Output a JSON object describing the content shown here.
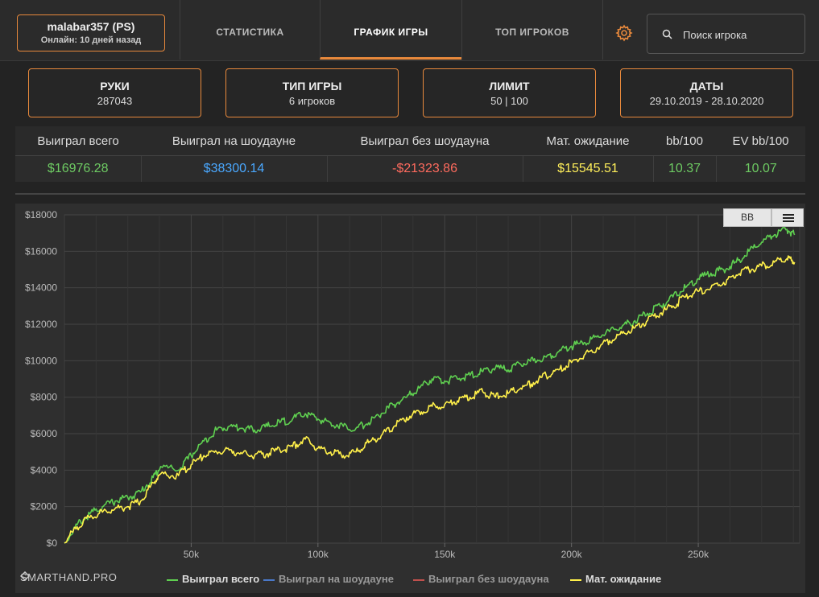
{
  "player": {
    "name": "malabar357 (PS)",
    "status": "Онлайн: 10 дней назад"
  },
  "nav": {
    "tabs": [
      {
        "label": "СТАТИСТИКА"
      },
      {
        "label": "ГРАФИК ИГРЫ"
      },
      {
        "label": "ТОП ИГРОКОВ"
      }
    ]
  },
  "search": {
    "placeholder": "Поиск игрока"
  },
  "cards": [
    {
      "title": "РУКИ",
      "value": "287043"
    },
    {
      "title": "ТИП ИГРЫ",
      "value": "6 игроков"
    },
    {
      "title": "ЛИМИТ",
      "value": "50 | 100"
    },
    {
      "title": "ДАТЫ",
      "value": "29.10.2019 - 28.10.2020"
    }
  ],
  "stats": {
    "headers": [
      "Выиграл всего",
      "Выиграл на шоудауне",
      "Выиграл без шоудауна",
      "Мат. ожидание",
      "bb/100",
      "EV bb/100"
    ],
    "values": [
      "$16976.28",
      "$38300.14",
      "-$21323.86",
      "$15545.51",
      "10.37",
      "10.07"
    ],
    "colors": [
      "#6ecb63",
      "#4aa8ff",
      "#ff6b5e",
      "#ffef5a",
      "#6ecb63",
      "#6ecb63"
    ]
  },
  "chart_controls": {
    "bb_label": "BB"
  },
  "brand": "SMARTHAND.PRO",
  "chart_data": {
    "type": "line",
    "xlim": [
      0,
      290000
    ],
    "ylim": [
      0,
      18000
    ],
    "y_ticks": [
      "$0",
      "$2000",
      "$4000",
      "$6000",
      "$8000",
      "$10000",
      "$12000",
      "$14000",
      "$16000",
      "$18000"
    ],
    "x_ticks": [
      "50k",
      "100k",
      "150k",
      "200k",
      "250k"
    ],
    "x_tick_values": [
      50000,
      100000,
      150000,
      200000,
      250000
    ],
    "grid": true,
    "legend_position": "bottom",
    "series": [
      {
        "name": "Выиграл всего",
        "color": "#5fcf50",
        "visible": true,
        "x": [
          0,
          5000,
          10000,
          15000,
          20000,
          25000,
          30000,
          35000,
          38000,
          45000,
          50000,
          55000,
          60000,
          65000,
          70000,
          75000,
          80000,
          85000,
          90000,
          95000,
          100000,
          105000,
          110000,
          115000,
          120000,
          125000,
          130000,
          135000,
          140000,
          145000,
          150000,
          155000,
          160000,
          165000,
          170000,
          175000,
          180000,
          185000,
          190000,
          195000,
          200000,
          205000,
          210000,
          215000,
          220000,
          225000,
          230000,
          235000,
          240000,
          245000,
          250000,
          255000,
          260000,
          265000,
          270000,
          275000,
          280000,
          285000,
          288000
        ],
        "y": [
          0,
          1000,
          1600,
          2000,
          2300,
          2500,
          2800,
          3600,
          4200,
          4000,
          4800,
          5600,
          6200,
          6400,
          6300,
          6200,
          6400,
          6600,
          6800,
          7100,
          6800,
          6600,
          6400,
          6300,
          6600,
          7100,
          7600,
          8000,
          8500,
          9000,
          8900,
          9000,
          9200,
          9400,
          9600,
          9500,
          9800,
          10000,
          10200,
          10500,
          10800,
          11000,
          11300,
          11600,
          11900,
          12200,
          12600,
          13000,
          13500,
          14000,
          14500,
          14800,
          15000,
          15400,
          16000,
          16500,
          16900,
          17200,
          16900
        ]
      },
      {
        "name": "Выиграл на шоудауне",
        "color": "#4a78c8",
        "visible": false,
        "x": [],
        "y": []
      },
      {
        "name": "Выиграл без шоудауна",
        "color": "#c0504d",
        "visible": false,
        "x": [],
        "y": []
      },
      {
        "name": "Мат. ожидание",
        "color": "#fff04a",
        "visible": true,
        "x": [
          0,
          5000,
          10000,
          15000,
          20000,
          25000,
          30000,
          35000,
          38000,
          45000,
          50000,
          55000,
          60000,
          65000,
          70000,
          75000,
          80000,
          85000,
          90000,
          95000,
          100000,
          105000,
          110000,
          115000,
          120000,
          125000,
          130000,
          135000,
          140000,
          145000,
          150000,
          155000,
          160000,
          165000,
          170000,
          175000,
          180000,
          185000,
          190000,
          195000,
          200000,
          205000,
          210000,
          215000,
          220000,
          225000,
          230000,
          235000,
          240000,
          245000,
          250000,
          255000,
          260000,
          265000,
          270000,
          275000,
          280000,
          285000,
          288000
        ],
        "y": [
          0,
          900,
          1400,
          1700,
          1900,
          2000,
          2300,
          3300,
          3800,
          3700,
          4300,
          4800,
          5000,
          5100,
          4900,
          4800,
          4900,
          5100,
          5300,
          5700,
          5200,
          5000,
          4800,
          5000,
          5500,
          5900,
          6400,
          6900,
          7200,
          7500,
          7600,
          7800,
          8000,
          8300,
          8000,
          8200,
          8500,
          8800,
          9200,
          9500,
          9900,
          10300,
          10700,
          11100,
          11500,
          11800,
          12200,
          12600,
          13000,
          13500,
          13800,
          14000,
          14300,
          14700,
          15000,
          15200,
          15400,
          15600,
          15400
        ]
      }
    ]
  }
}
